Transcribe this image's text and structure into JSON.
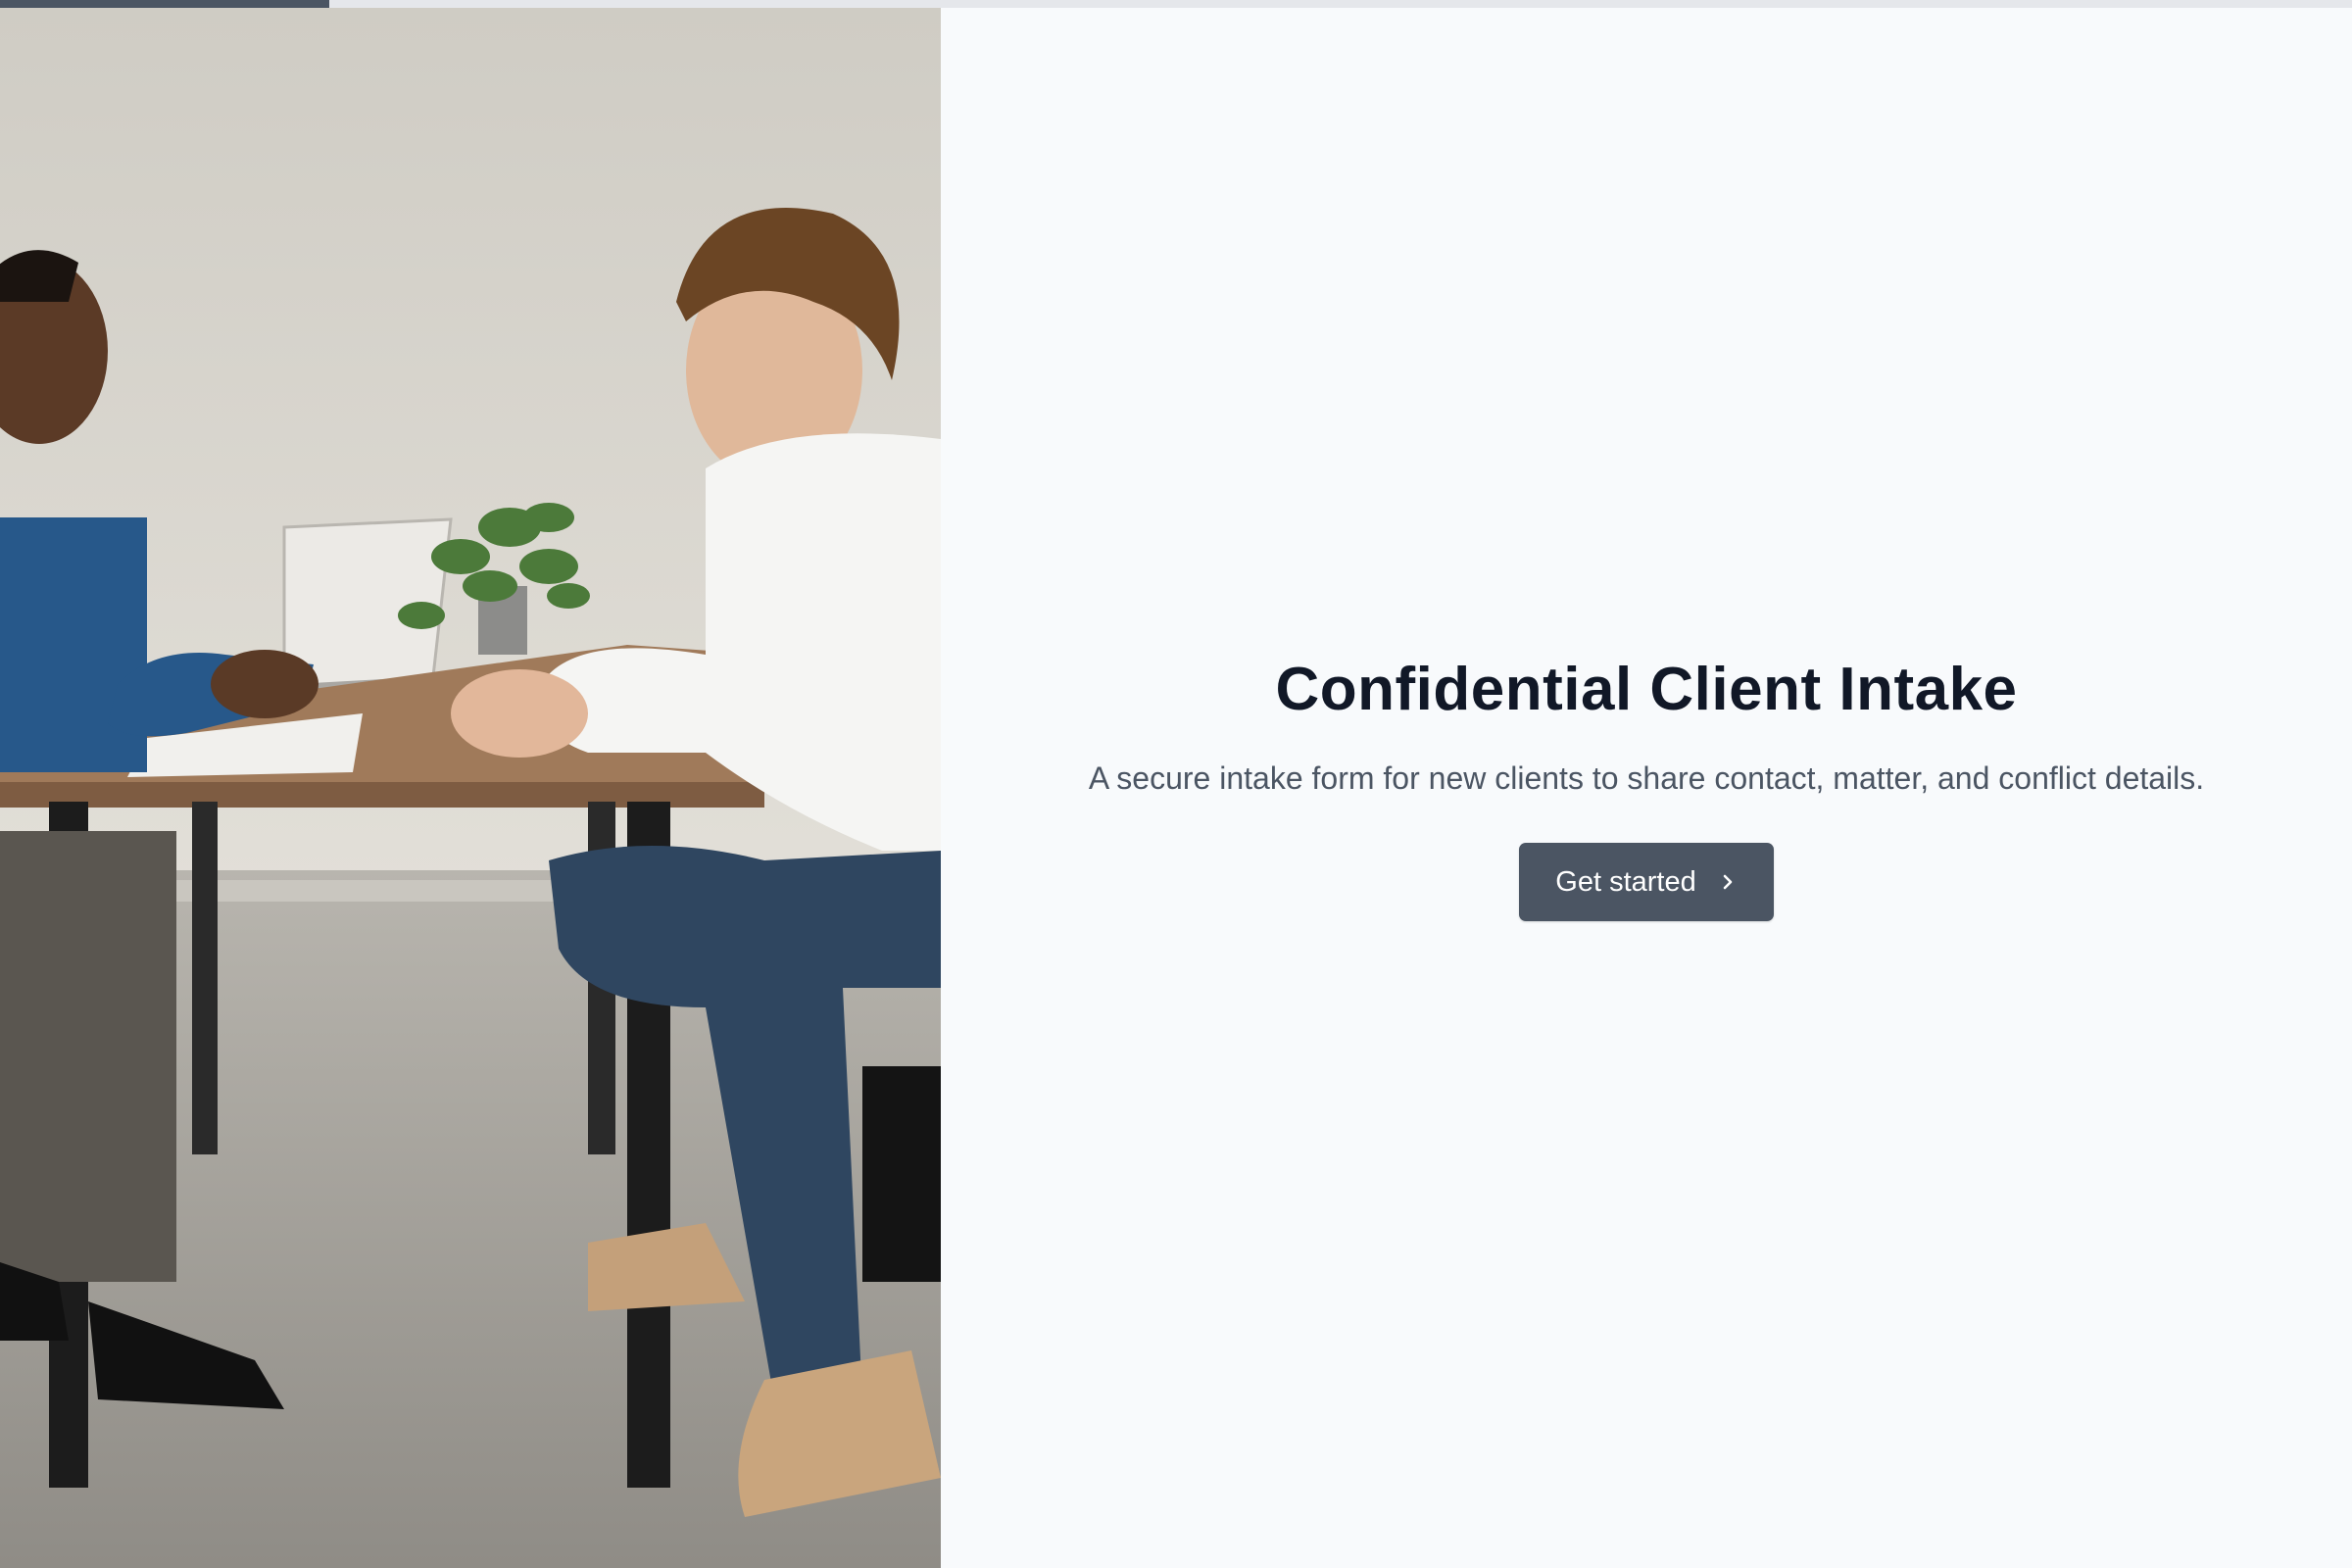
{
  "progress": {
    "fraction": 0.14
  },
  "hero_image": {
    "alt": "Two people talking across a table"
  },
  "intro": {
    "title": "Confidential Client Intake",
    "subtitle": "A secure intake form for new clients to share contact, matter, and conflict details.",
    "cta_label": "Get started",
    "cta_icon": "chevron-right-icon"
  },
  "colors": {
    "accent": "#4b5563",
    "title": "#111827",
    "subtitle": "#4b5563",
    "background": "#f8fafc",
    "track": "#e5e7eb"
  }
}
